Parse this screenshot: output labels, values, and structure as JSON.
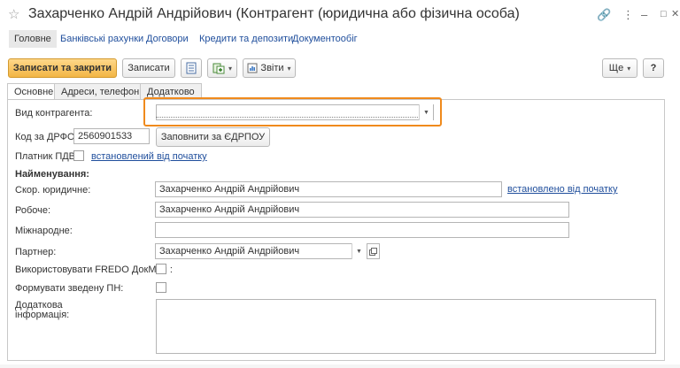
{
  "window": {
    "title": "Захарченко Андрій Андрійович  (Контрагент (юридична або фізична особа)",
    "controls": {
      "link": "🔗",
      "menu": "⋮",
      "minimize": "–",
      "maximize": "□",
      "close": "✕"
    }
  },
  "nav": {
    "items": [
      "Головне",
      "Банківські рахунки",
      "Договори",
      "Кредити та депозити",
      "Документообіг"
    ]
  },
  "toolbar": {
    "save_close": "Записати та закрити",
    "save": "Записати",
    "reports": "Звіти",
    "more": "Ще",
    "help": "?"
  },
  "tabs": [
    "Основне",
    "Адреси, телефони",
    "Додатково"
  ],
  "form": {
    "kind_label": "Вид контрагента:",
    "kind_value": "",
    "drfo_label": "Код за ДРФО:",
    "drfo_value": "2560901533",
    "fill_button": "Заповнити за ЄДРПОУ",
    "vat_label": "Платник ПДВ:",
    "vat_link": "встановлений від початку",
    "names_heading": "Найменування:",
    "short_label": "Скор. юридичне:",
    "short_value": "Захарченко Андрій Андрійович",
    "short_link": "встановлено від початку",
    "work_label": "Робоче:",
    "work_value": "Захарченко Андрій Андрійович",
    "intl_label": "Міжнародне:",
    "intl_value": "",
    "partner_label": "Партнер:",
    "partner_value": "Захарченко Андрій Андрійович",
    "fredo_label": "Використовувати FREDO ДокМен :",
    "pn_label": "Формувати зведену ПН:",
    "extra_label_1": "Додаткова",
    "extra_label_2": "інформація:"
  }
}
